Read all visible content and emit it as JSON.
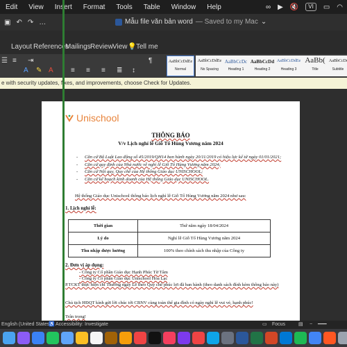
{
  "menubar": {
    "items": [
      "Edit",
      "View",
      "Insert",
      "Format",
      "Tools",
      "Table",
      "Window",
      "Help"
    ],
    "input_badge": "VI"
  },
  "titlebar": {
    "document_title": "Mẫu file văn bản word",
    "save_status": "— Saved to my Mac",
    "chevron": "⌄"
  },
  "ribbon": {
    "tabs": [
      "Layout",
      "References",
      "Mailings",
      "Review",
      "View",
      "Tell me"
    ],
    "styles": [
      {
        "sample": "AaBbCcDdEe",
        "label": "Normal"
      },
      {
        "sample": "AaBbCcDdEe",
        "label": "No Spacing"
      },
      {
        "sample": "AaBbCcDc",
        "label": "Heading 1"
      },
      {
        "sample": "AaBbCcDd",
        "label": "Heading 2"
      },
      {
        "sample": "AaBbCcDdEe",
        "label": "Heading 3"
      },
      {
        "sample": "AaBb(",
        "label": "Title"
      },
      {
        "sample": "AaBbCcDdEe",
        "label": "Subtitle"
      }
    ]
  },
  "updatebar": {
    "text": "e with security updates, fixes, and improvements, choose Check for Updates."
  },
  "document": {
    "logo_text": "Unischool",
    "title": "THÔNG BÁO",
    "subtitle": "V/v Lịch nghỉ lễ Giỗ Tổ Hùng Vương năm 2024",
    "bases": [
      "Căn cứ Bộ Luật Lao động số 45/2019/QH14 ban hành ngày 20/11/2019 có hiệu lực kể từ ngày 01/01/2021;",
      "Căn cứ quy định của Nhà nước về nghỉ lễ Giỗ Tổ Hùng Vương năm 2024;",
      "Căn cứ Nội quy, Quy chế của Hệ thống Giáo dục UNISCHOOL;",
      "Căn cứ kế hoạch kinh doanh của Hệ thống Giáo dục UNISCHOOL."
    ],
    "intro": "Hệ thống Giáo dục Unischool thông báo lịch nghỉ lễ Giỗ Tổ Hùng Vương năm 2024 như sau:",
    "section1": "1. Lịch nghỉ lễ:",
    "table": [
      {
        "key": "Thời gian",
        "value": "Thứ năm ngày 18/04/2024"
      },
      {
        "key": "Lý do",
        "value": "Nghỉ lễ Giỗ Tổ Hùng Vương năm 2024"
      },
      {
        "key": "Thu nhập được hưởng",
        "value": "100% theo chính sách thu nhập của Công ty"
      }
    ],
    "section2": "2. Đơn vị áp dụng:",
    "units": [
      "- Công ty Cổ phần Giáo dục Hạnh Phúc Từ Tâm",
      "- Công ty Cổ phần Giáo dục Unischool Hòa Lạc"
    ],
    "note": "P.TCKT thực hiện chi Thưởng ngày Lễ theo Quy chế phúc lợi đã ban hành (theo danh sách đính kèm thông báo này)",
    "wish": "Chủ tịch HĐQT kính gửi lời chúc tới CBNV cùng toàn thể gia đình có ngày nghỉ lễ vui vẻ, hạnh phúc!",
    "closing": "Trân trọng!"
  },
  "statusbar": {
    "language": "English (United States)",
    "accessibility": "Accessibility: Investigate",
    "focus": "Focus"
  },
  "colors": {
    "logo_orange": "#e8833a",
    "word_blue": "#2b579a",
    "update_bar": "#f5f3d6"
  }
}
